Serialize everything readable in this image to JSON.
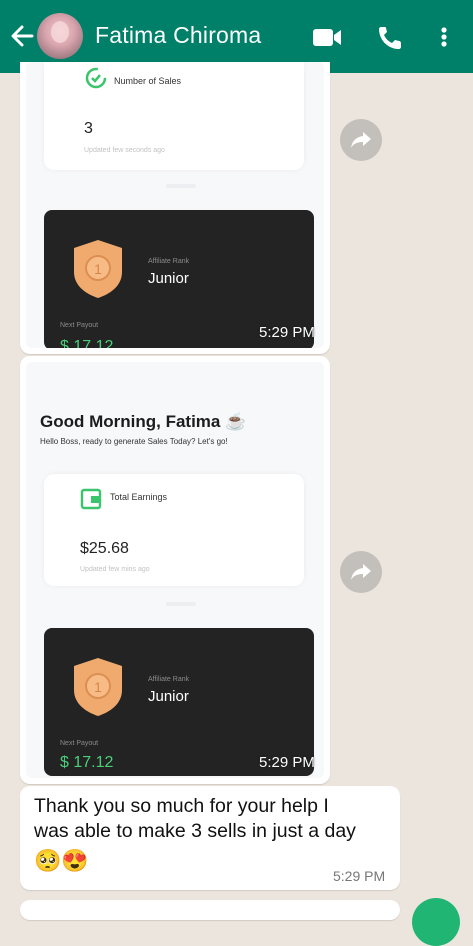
{
  "header": {
    "contact_name": "Fatima Chiroma",
    "back_icon": "back-arrow-icon",
    "video_icon": "video-call-icon",
    "phone_icon": "phone-call-icon",
    "more_icon": "more-vert-icon",
    "bg_color": "#008069"
  },
  "messages": [
    {
      "type": "image",
      "stat_label": "Number of Sales",
      "stat_value": "3",
      "stat_sub": "Updated few seconds ago",
      "tier_label": "Affiliate Rank",
      "tier_name": "Junior",
      "badge_number": "1",
      "payout_label": "Next Payout",
      "payout_value": "$ 17.12",
      "time": "5:29 PM"
    },
    {
      "type": "image",
      "greeting": "Good Morning, Fatima ☕",
      "greeting_sub": "Hello Boss, ready to generate Sales Today? Let's go!",
      "stat_label": "Total Earnings",
      "stat_value": "$25.68",
      "stat_sub": "Updated few mins ago",
      "tier_label": "Affiliate Rank",
      "tier_name": "Junior",
      "badge_number": "1",
      "payout_label": "Next Payout",
      "payout_value": "$ 17.12",
      "time": "5:29 PM"
    },
    {
      "type": "text",
      "line1": "Thank you so much for your help I",
      "line2": "was able to make 3 sells in just a day",
      "emoji": "🥺😍",
      "time": "5:29 PM"
    }
  ]
}
